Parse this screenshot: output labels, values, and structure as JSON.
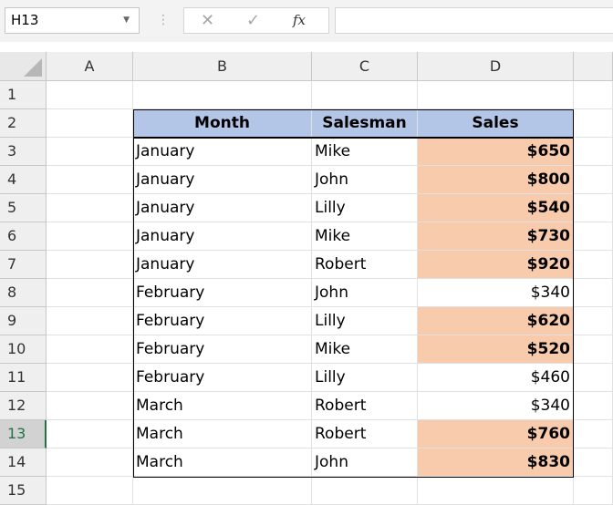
{
  "name_box": "H13",
  "formula_bar": {
    "fx_label": "fx",
    "cancel_glyph": "✕",
    "enter_glyph": "✓",
    "value": ""
  },
  "columns": [
    "A",
    "B",
    "C",
    "D"
  ],
  "rows": [
    "1",
    "2",
    "3",
    "4",
    "5",
    "6",
    "7",
    "8",
    "9",
    "10",
    "11",
    "12",
    "13",
    "14",
    "15"
  ],
  "active_row": "13",
  "table": {
    "headers": {
      "month": "Month",
      "salesman": "Salesman",
      "sales": "Sales"
    },
    "records": [
      {
        "month": "January",
        "salesman": "Mike",
        "sales": "$650",
        "highlight": true
      },
      {
        "month": "January",
        "salesman": "John",
        "sales": "$800",
        "highlight": true
      },
      {
        "month": "January",
        "salesman": "Lilly",
        "sales": "$540",
        "highlight": true
      },
      {
        "month": "January",
        "salesman": "Mike",
        "sales": "$730",
        "highlight": true
      },
      {
        "month": "January",
        "salesman": "Robert",
        "sales": "$920",
        "highlight": true
      },
      {
        "month": "February",
        "salesman": "John",
        "sales": "$340",
        "highlight": false
      },
      {
        "month": "February",
        "salesman": "Lilly",
        "sales": "$620",
        "highlight": true
      },
      {
        "month": "February",
        "salesman": "Mike",
        "sales": "$520",
        "highlight": true
      },
      {
        "month": "February",
        "salesman": "Lilly",
        "sales": "$460",
        "highlight": false
      },
      {
        "month": "March",
        "salesman": "Robert",
        "sales": "$340",
        "highlight": false
      },
      {
        "month": "March",
        "salesman": "Robert",
        "sales": "$760",
        "highlight": true
      },
      {
        "month": "March",
        "salesman": "John",
        "sales": "$830",
        "highlight": true
      }
    ]
  },
  "colors": {
    "header_fill": "#b4c6e7",
    "highlight_fill": "#f8cbad",
    "excel_green": "#217346"
  }
}
